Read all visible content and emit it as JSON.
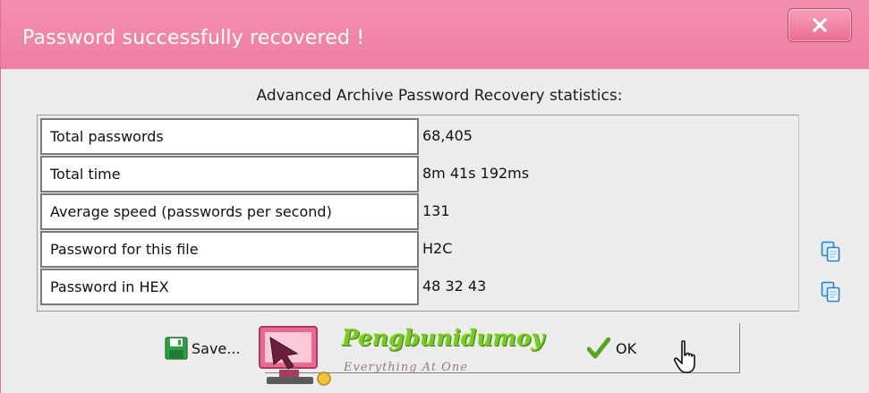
{
  "window": {
    "title": "Password successfully recovered !",
    "close_icon": "close-icon"
  },
  "heading": "Advanced Archive Password Recovery statistics:",
  "stats": [
    {
      "label": "Total passwords",
      "value": "68,405"
    },
    {
      "label": "Total time",
      "value": "8m 41s 192ms"
    },
    {
      "label": "Average speed (passwords per second)",
      "value": "131"
    },
    {
      "label": "Password for this file",
      "value": "H2C"
    },
    {
      "label": "Password in HEX",
      "value": "48 32 43"
    }
  ],
  "buttons": {
    "save_label": "Save...",
    "ok_label": "OK"
  },
  "watermark": {
    "title": "Pengbunidumoy",
    "tagline": "Everything At One"
  },
  "colors": {
    "titlebar": "#ef7ea2",
    "close_button": "#ea6d93",
    "accent_green": "#58a51f",
    "floppy_green": "#2ea043"
  }
}
